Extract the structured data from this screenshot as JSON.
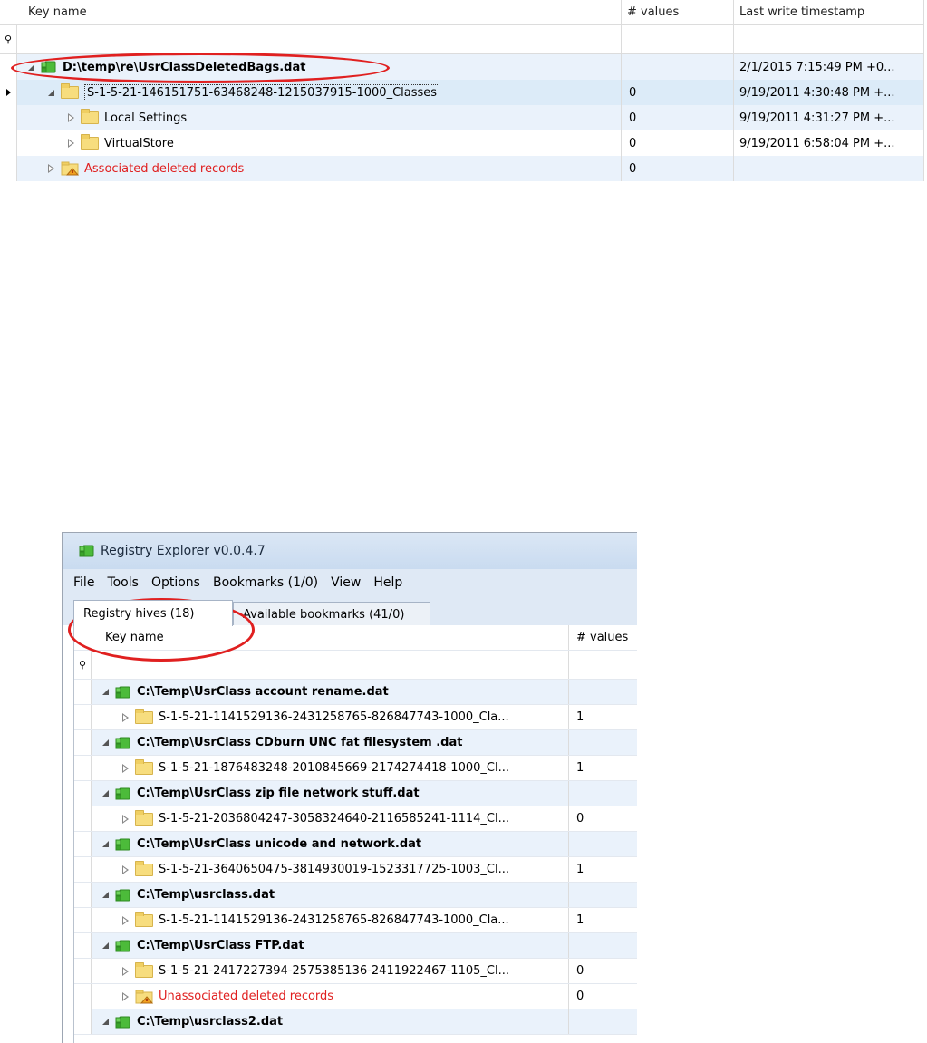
{
  "top_grid": {
    "columns": [
      "Key name",
      "# values",
      "Last write timestamp"
    ],
    "rows": [
      {
        "level": 0,
        "expander": "open",
        "icon": "hive-icon",
        "name": "D:\\temp\\re\\UsrClassDeletedBags.dat",
        "bold": true,
        "values": "",
        "timestamp": "2/1/2015 7:15:49 PM +0...",
        "style": "blue",
        "marker": false
      },
      {
        "level": 1,
        "expander": "open",
        "icon": "folder-icon",
        "name": "S-1-5-21-146151751-63468248-1215037915-1000_Classes",
        "bold": false,
        "values": "0",
        "timestamp": "9/19/2011 4:30:48 PM +...",
        "style": "sel",
        "marker": true
      },
      {
        "level": 2,
        "expander": "closed",
        "icon": "folder-icon",
        "name": "Local Settings",
        "bold": false,
        "values": "0",
        "timestamp": "9/19/2011 4:31:27 PM +...",
        "style": "blue",
        "marker": false
      },
      {
        "level": 2,
        "expander": "closed",
        "icon": "folder-icon",
        "name": "VirtualStore",
        "bold": false,
        "values": "0",
        "timestamp": "9/19/2011 6:58:04 PM +...",
        "style": "white",
        "marker": false
      },
      {
        "level": 1,
        "expander": "closed",
        "icon": "warn-icon",
        "name": "Associated deleted records",
        "bold": false,
        "red": true,
        "values": "0",
        "timestamp": "",
        "style": "blue",
        "marker": false
      }
    ]
  },
  "window": {
    "title": "Registry Explorer v0.0.4.7",
    "menu": [
      "File",
      "Tools",
      "Options",
      "Bookmarks (1/0)",
      "View",
      "Help"
    ],
    "tabs": [
      "Registry hives (18)",
      "Available bookmarks (41/0)"
    ],
    "columns": [
      "Key name",
      "# values"
    ],
    "rows": [
      {
        "level": 0,
        "expander": "open",
        "icon": "hive-icon",
        "name": "C:\\Temp\\UsrClass account rename.dat",
        "bold": true,
        "values": ""
      },
      {
        "level": 1,
        "expander": "closed",
        "icon": "folder-icon",
        "name": "S-1-5-21-1141529136-2431258765-826847743-1000_Cla...",
        "bold": false,
        "values": "1"
      },
      {
        "level": 0,
        "expander": "open",
        "icon": "hive-icon",
        "name": "C:\\Temp\\UsrClass CDburn UNC fat filesystem .dat",
        "bold": true,
        "values": ""
      },
      {
        "level": 1,
        "expander": "closed",
        "icon": "folder-icon",
        "name": "S-1-5-21-1876483248-2010845669-2174274418-1000_Cl...",
        "bold": false,
        "values": "1"
      },
      {
        "level": 0,
        "expander": "open",
        "icon": "hive-icon",
        "name": "C:\\Temp\\UsrClass zip file network stuff.dat",
        "bold": true,
        "values": ""
      },
      {
        "level": 1,
        "expander": "closed",
        "icon": "folder-icon",
        "name": "S-1-5-21-2036804247-3058324640-2116585241-1114_Cl...",
        "bold": false,
        "values": "0"
      },
      {
        "level": 0,
        "expander": "open",
        "icon": "hive-icon",
        "name": "C:\\Temp\\UsrClass unicode and network.dat",
        "bold": true,
        "values": ""
      },
      {
        "level": 1,
        "expander": "closed",
        "icon": "folder-icon",
        "name": "S-1-5-21-3640650475-3814930019-1523317725-1003_Cl...",
        "bold": false,
        "values": "1"
      },
      {
        "level": 0,
        "expander": "open",
        "icon": "hive-icon",
        "name": "C:\\Temp\\usrclass.dat",
        "bold": true,
        "values": ""
      },
      {
        "level": 1,
        "expander": "closed",
        "icon": "folder-icon",
        "name": "S-1-5-21-1141529136-2431258765-826847743-1000_Cla...",
        "bold": false,
        "values": "1"
      },
      {
        "level": 0,
        "expander": "open",
        "icon": "hive-icon",
        "name": "C:\\Temp\\UsrClass FTP.dat",
        "bold": true,
        "values": ""
      },
      {
        "level": 1,
        "expander": "closed",
        "icon": "folder-icon",
        "name": "S-1-5-21-2417227394-2575385136-2411922467-1105_Cl...",
        "bold": false,
        "values": "0"
      },
      {
        "level": 1,
        "expander": "closed",
        "icon": "warn-icon",
        "name": "Unassociated deleted records",
        "bold": false,
        "red": true,
        "values": "0"
      },
      {
        "level": 0,
        "expander": "open",
        "icon": "hive-icon",
        "name": "C:\\Temp\\usrclass2.dat",
        "bold": true,
        "values": ""
      }
    ]
  },
  "colors": {
    "highlight_circle": "#e02020",
    "deleted_text": "#e02020",
    "row_alt": "#eaf2fb",
    "hive_green": "#4cbb3a",
    "folder_yellow": "#f7dd7e"
  }
}
